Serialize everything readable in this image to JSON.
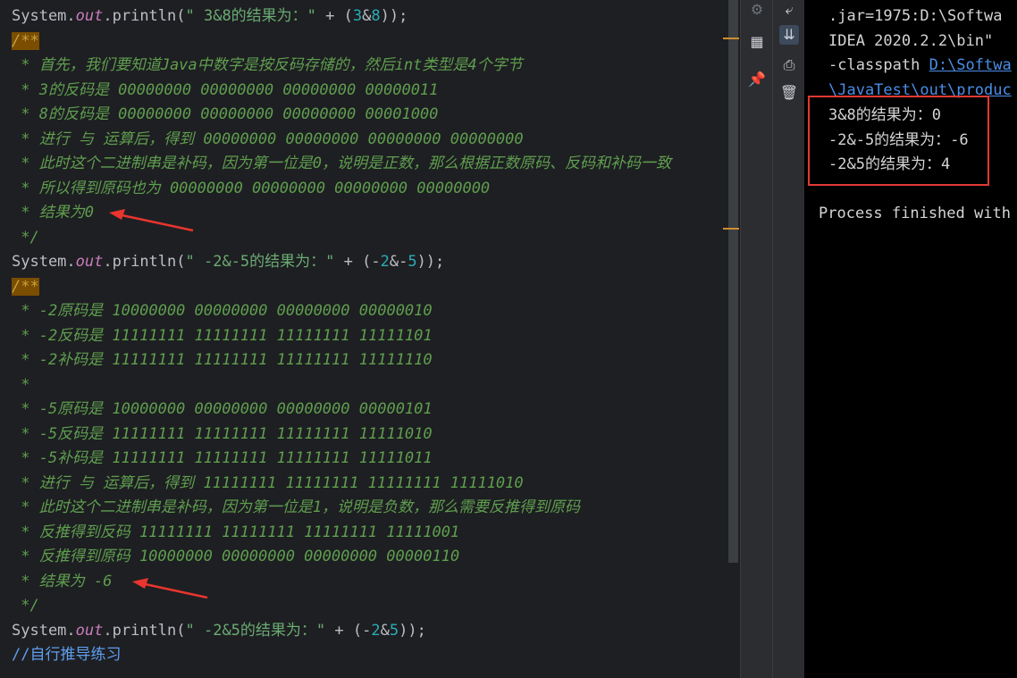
{
  "editor": {
    "lines": [
      {
        "segs": [
          [
            "System.",
            ""
          ],
          [
            "out",
            "kw-field"
          ],
          [
            ".println(",
            ""
          ],
          [
            "\" 3&8的结果为：\" ",
            "str"
          ],
          [
            "+ (",
            ""
          ],
          [
            "3",
            "num"
          ],
          [
            "&",
            ""
          ],
          [
            "8",
            "num"
          ],
          [
            "));",
            "paren"
          ]
        ]
      },
      {
        "segs": [
          [
            "/**",
            "cmt-open"
          ]
        ]
      },
      {
        "segs": [
          [
            " * 首先，我们要知道Java中数字是按反码存储的，然后int类型是4个字节",
            "cmt"
          ]
        ]
      },
      {
        "segs": [
          [
            " * 3的反码是 00000000 00000000 00000000 00000011",
            "cmt"
          ]
        ]
      },
      {
        "segs": [
          [
            " * 8的反码是 00000000 00000000 00000000 00001000",
            "cmt"
          ]
        ]
      },
      {
        "segs": [
          [
            " * 进行 与 运算后，得到 00000000 00000000 00000000 00000000",
            "cmt"
          ]
        ]
      },
      {
        "segs": [
          [
            " * 此时这个二进制串是补码，因为第一位是0，说明是正数，那么根据正数原码、反码和补码一致",
            "cmt"
          ]
        ]
      },
      {
        "segs": [
          [
            " * 所以得到原码也为 00000000 00000000 00000000 00000000",
            "cmt"
          ]
        ]
      },
      {
        "segs": [
          [
            " * 结果为0",
            "cmt"
          ]
        ]
      },
      {
        "segs": [
          [
            " */",
            "cmt"
          ]
        ]
      },
      {
        "segs": [
          [
            "System.",
            ""
          ],
          [
            "out",
            "kw-field"
          ],
          [
            ".println(",
            ""
          ],
          [
            "\" -2&-5的结果为：\" ",
            "str"
          ],
          [
            "+ (-",
            ""
          ],
          [
            "2",
            "num"
          ],
          [
            "&-",
            ""
          ],
          [
            "5",
            "num"
          ],
          [
            "));",
            "paren"
          ]
        ]
      },
      {
        "segs": [
          [
            "/**",
            "cmt-open"
          ]
        ]
      },
      {
        "segs": [
          [
            " * -2原码是 10000000 00000000 00000000 00000010",
            "cmt"
          ]
        ]
      },
      {
        "segs": [
          [
            " * -2反码是 11111111 11111111 11111111 11111101",
            "cmt"
          ]
        ]
      },
      {
        "segs": [
          [
            " * -2补码是 11111111 11111111 11111111 11111110",
            "cmt"
          ]
        ]
      },
      {
        "segs": [
          [
            " *",
            "cmt"
          ]
        ]
      },
      {
        "segs": [
          [
            " * -5原码是 10000000 00000000 00000000 00000101",
            "cmt"
          ]
        ]
      },
      {
        "segs": [
          [
            " * -5反码是 11111111 11111111 11111111 11111010",
            "cmt"
          ]
        ]
      },
      {
        "segs": [
          [
            " * -5补码是 11111111 11111111 11111111 11111011",
            "cmt"
          ]
        ]
      },
      {
        "segs": [
          [
            " * 进行 与 运算后，得到 11111111 11111111 11111111 11111010",
            "cmt"
          ]
        ]
      },
      {
        "segs": [
          [
            " * 此时这个二进制串是补码，因为第一位是1，说明是负数，那么需要反推得到原码",
            "cmt"
          ]
        ]
      },
      {
        "segs": [
          [
            " * 反推得到反码 11111111 11111111 11111111 11111001",
            "cmt"
          ]
        ]
      },
      {
        "segs": [
          [
            " * 反推得到原码 10000000 00000000 00000000 00000110",
            "cmt"
          ]
        ]
      },
      {
        "segs": [
          [
            " * 结果为 -6",
            "cmt"
          ]
        ]
      },
      {
        "segs": [
          [
            " */",
            "cmt"
          ]
        ]
      },
      {
        "segs": [
          [
            "System.",
            ""
          ],
          [
            "out",
            "kw-field"
          ],
          [
            ".println(",
            ""
          ],
          [
            "\" -2&5的结果为：\" ",
            "str"
          ],
          [
            "+ (-",
            ""
          ],
          [
            "2",
            "num"
          ],
          [
            "&",
            ""
          ],
          [
            "5",
            "num"
          ],
          [
            "));",
            "paren"
          ]
        ]
      },
      {
        "segs": [
          [
            "//自行推导练习",
            "line-comment"
          ]
        ]
      }
    ]
  },
  "toolwindow": {
    "icons": [
      "settings-icon",
      "layout-icon",
      "pin-icon"
    ]
  },
  "run_toolbar": {
    "icons": [
      "soft-wrap-icon",
      "scroll-to-end-icon",
      "print-icon",
      "trash-icon"
    ]
  },
  "console": {
    "lines": [
      [
        ".jar=1975:D:\\Softwa",
        ""
      ],
      [
        "IDEA 2020.2.2\\bin\" ",
        ""
      ],
      [
        "-classpath ",
        ""
      ],
      [
        "\\JavaTest\\out\\produc",
        "link"
      ]
    ],
    "classpath_link": "D:\\Softwa",
    "results": [
      "3&8的结果为：0",
      "-2&-5的结果为：-6",
      "-2&5的结果为：4"
    ],
    "process_finished": "Process finished with"
  }
}
